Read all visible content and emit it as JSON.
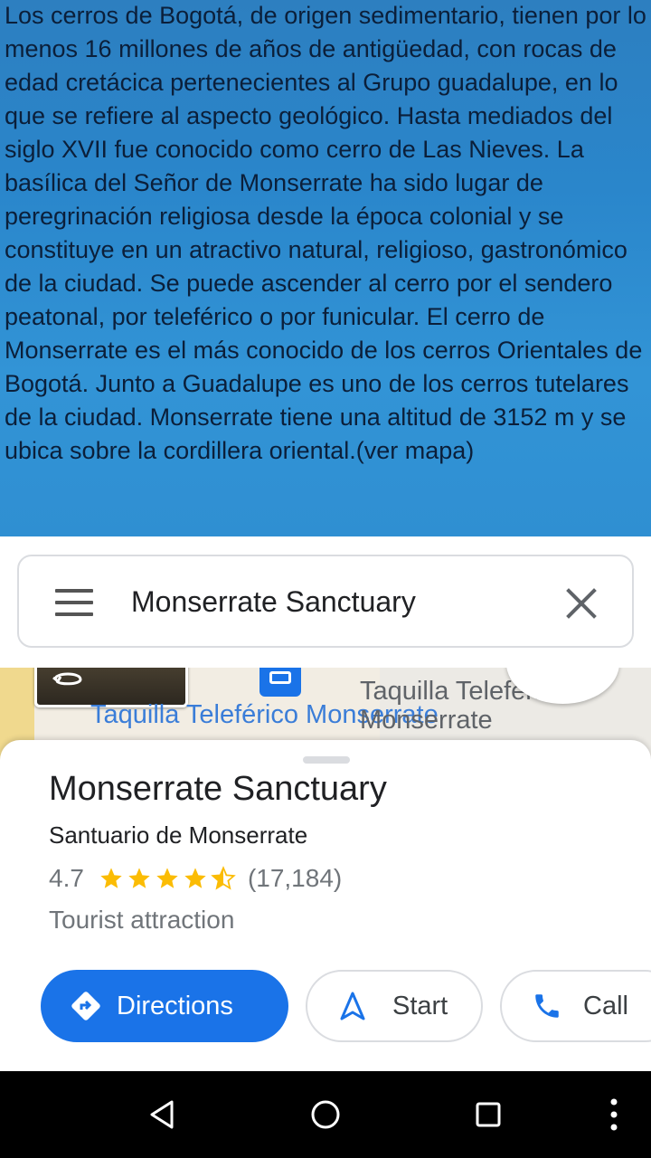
{
  "article": {
    "text": "Los cerros de Bogotá, de origen sedimentario, tienen por lo menos 16 millones de años de antigüedad, con rocas de edad cretácica pertenecientes al Grupo guadalupe, en lo que se refiere al aspecto geológico. Hasta mediados del siglo XVII fue conocido como cerro de Las Nieves. La basílica del Señor de Monserrate ha sido lugar de peregrinación religiosa desde la época colonial y se constituye en un atractivo natural, religioso, gastronómico de la ciudad. Se puede ascender al cerro por el sendero peatonal, por teleférico o por funicular. El cerro de Monserrate es el más conocido de los cerros Orientales de Bogotá. Junto a Guadalupe es uno de los cerros tutelares de la ciudad. Monserrate tiene una altitud de 3152 m y se ubica sobre la cordillera oriental.(ver mapa)",
    "background_color": "#2a86cb"
  },
  "search": {
    "query": "Monserrate Sanctuary",
    "menu_icon": "menu-icon",
    "close_icon": "close-icon"
  },
  "map": {
    "label_left": "Taquilla Teleférico Monserrate",
    "label_right": "Taquilla Teleférico Monserrate",
    "pin_icon": "cable-car-icon"
  },
  "place": {
    "name": "Monserrate Sanctuary",
    "local_name": "Santuario de Monserrate",
    "rating": "4.7",
    "rating_value": 4.7,
    "review_count": "(17,184)",
    "category": "Tourist attraction"
  },
  "actions": {
    "directions": "Directions",
    "start": "Start",
    "call": "Call"
  },
  "colors": {
    "accent": "#1a73e8",
    "star": "#fbbc04"
  },
  "navbar": {
    "back_icon": "back-icon",
    "home_icon": "home-icon",
    "recents_icon": "recents-icon",
    "more_icon": "more-vert-icon"
  }
}
